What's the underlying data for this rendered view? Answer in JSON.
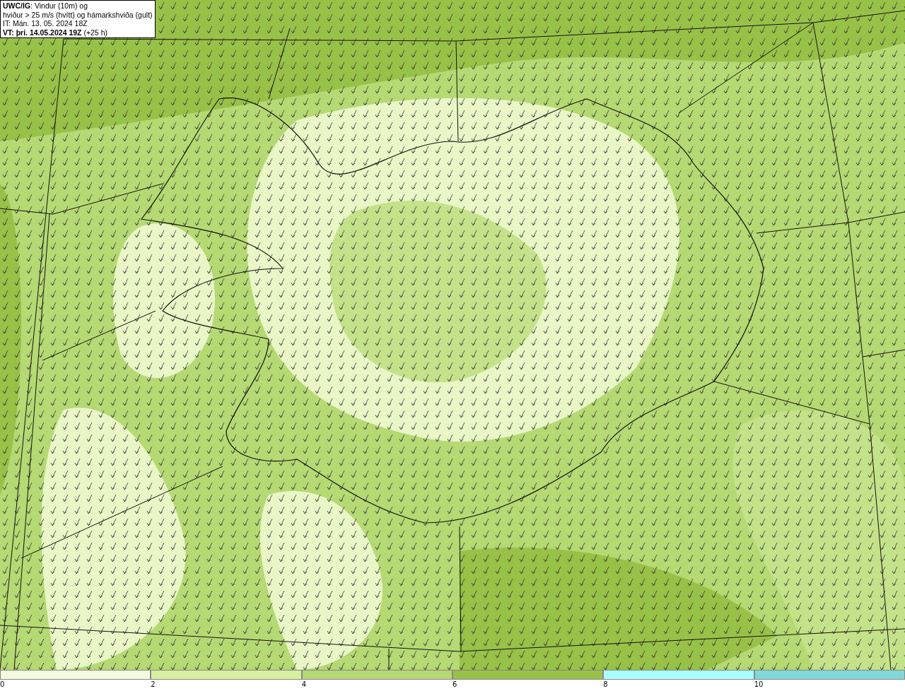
{
  "title_box": {
    "lines": [
      "**UWC/IG**: Vindur (10m) og",
      "hviður > 25 m/s (hvítt) og hámarkshviða (gult)",
      "IT: Mán. 13. 05. 2024 18Z",
      "**VT: þri. 14.05.2024 19Z** (+25 h)"
    ]
  },
  "legend": [
    {
      "label": "0",
      "color": "#f4fbdf"
    },
    {
      "label": "2",
      "color": "#d6f09f"
    },
    {
      "label": "4",
      "color": "#b5d973"
    },
    {
      "label": "6",
      "color": "#98c148"
    },
    {
      "label": "8",
      "color": "#aaffff"
    },
    {
      "label": "10",
      "color": "#80d8d8"
    }
  ]
}
